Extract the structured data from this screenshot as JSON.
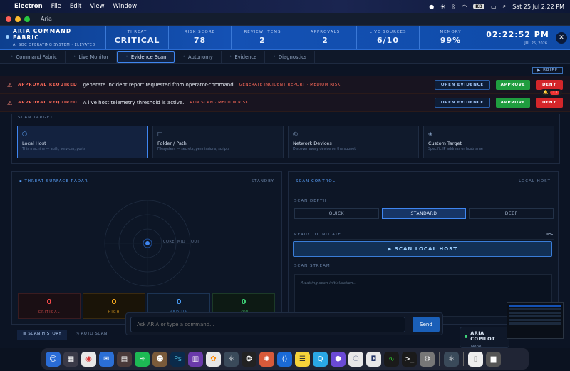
{
  "menubar": {
    "app": "Electron",
    "menus": [
      "File",
      "Edit",
      "View",
      "Window"
    ],
    "datetime": "Sat 25 Jul  2:22 PM",
    "badge": "KB"
  },
  "window": {
    "title": "Aria"
  },
  "header": {
    "brand": "ARIA COMMAND FABRIC",
    "subtitle": "AI SOC OPERATING SYSTEM · ELEVATED",
    "stats": [
      {
        "label": "THREAT",
        "value": "CRITICAL"
      },
      {
        "label": "RISK SCORE",
        "value": "78"
      },
      {
        "label": "REVIEW ITEMS",
        "value": "2"
      },
      {
        "label": "APPROVALS",
        "value": "2"
      },
      {
        "label": "LIVE SOURCES",
        "value": "6/10"
      },
      {
        "label": "MEMORY",
        "value": "99%"
      }
    ],
    "clock": "02:22:52 PM",
    "date": "JUL 25, 2026"
  },
  "tabs": [
    "Command Fabric",
    "Live Monitor",
    "Evidence Scan",
    "Autonomy",
    "Evidence",
    "Diagnostics"
  ],
  "brief_label": "BRIEF",
  "approvals": [
    {
      "req": "APPROVAL REQUIRED",
      "msg": "generate incident report requested from operator-command",
      "tag": "GENERATE INCIDENT REPORT · MEDIUM RISK",
      "open": "OPEN EVIDENCE",
      "approve": "APPROVE",
      "deny": "DENY"
    },
    {
      "req": "APPROVAL REQUIRED",
      "msg": "A live host telemetry threshold is active.",
      "tag": "RUN SCAN · MEDIUM RISK",
      "open": "OPEN EVIDENCE",
      "approve": "APPROVE",
      "deny": "DENY"
    }
  ],
  "notif_count": "11",
  "scan_target": {
    "label": "SCAN TARGET",
    "cards": [
      {
        "title": "Local Host",
        "desc": "This machine — auth, services, ports",
        "icon": "hexagon-icon"
      },
      {
        "title": "Folder / Path",
        "desc": "Filesystem — secrets, permissions, scripts",
        "icon": "folder-icon"
      },
      {
        "title": "Network Devices",
        "desc": "Discover every device on the subnet",
        "icon": "network-icon"
      },
      {
        "title": "Custom Target",
        "desc": "Specific IP address or hostname",
        "icon": "diamond-icon"
      }
    ]
  },
  "radar": {
    "title": "THREAT SURFACE RADAR",
    "status": "STANDBY",
    "rings": [
      "CORE",
      "MID",
      "OUT"
    ],
    "severities": [
      {
        "count": "0",
        "label": "CRITICAL",
        "color": "#ff4d4d"
      },
      {
        "count": "0",
        "label": "HIGH",
        "color": "#ffb020"
      },
      {
        "count": "0",
        "label": "MEDIUM",
        "color": "#4da3ff"
      },
      {
        "count": "0",
        "label": "LOW",
        "color": "#3fd67a"
      }
    ]
  },
  "scan_control": {
    "title": "SCAN CONTROL",
    "target": "LOCAL HOST",
    "depth_label": "SCAN DEPTH",
    "depths": [
      "QUICK",
      "STANDARD",
      "DEEP"
    ],
    "selected_depth": "STANDARD",
    "ready": "READY TO INITIATE",
    "progress": "0%",
    "progress_value": 0,
    "button": "▶ SCAN LOCAL HOST",
    "stream_label": "SCAN STREAM",
    "stream_text": "Awaiting scan initialisation..."
  },
  "history_tabs": [
    "SCAN HISTORY",
    "AUTO SCAN"
  ],
  "ask": {
    "placeholder": "Ask ARIA or type a command...",
    "send": "Send"
  },
  "copilot": {
    "title": "ARIA COPILOT",
    "status": "None"
  }
}
